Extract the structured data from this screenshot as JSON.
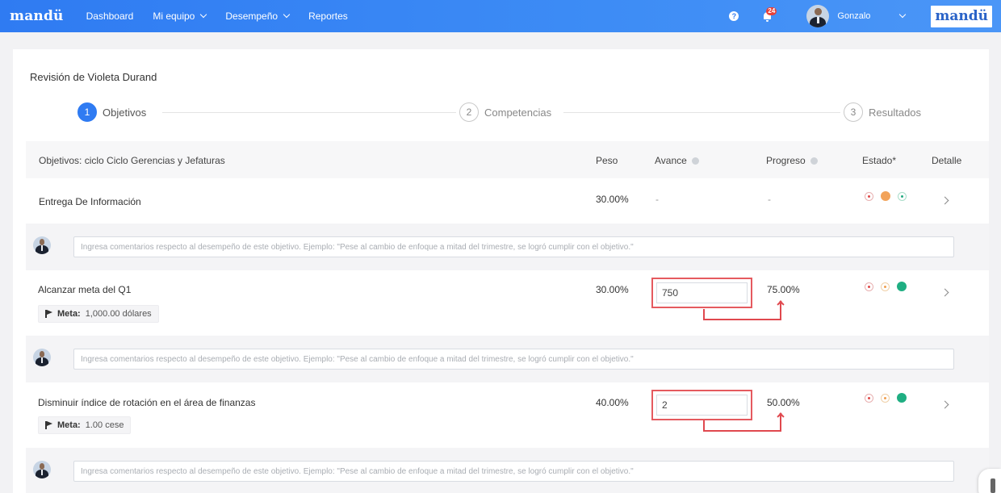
{
  "nav": {
    "brand": "mandü",
    "items": [
      {
        "label": "Dashboard",
        "has_dropdown": false
      },
      {
        "label": "Mi equipo",
        "has_dropdown": true
      },
      {
        "label": "Desempeño",
        "has_dropdown": true
      },
      {
        "label": "Reportes",
        "has_dropdown": false
      }
    ],
    "help_icon": "?",
    "notifications_count": "24",
    "user_name": "Gonzalo",
    "brand_right": "mandü",
    "accent": "#2f7bf2"
  },
  "review": {
    "title": "Revisión de Violeta Durand"
  },
  "steps": [
    {
      "number": "1",
      "label": "Objetivos",
      "active": true
    },
    {
      "number": "2",
      "label": "Competencias",
      "active": false
    },
    {
      "number": "3",
      "label": "Resultados",
      "active": false
    }
  ],
  "table": {
    "headers": {
      "objective": "Objetivos: ciclo Ciclo Gerencias y Jefaturas",
      "peso": "Peso",
      "avance": "Avance",
      "progreso": "Progreso",
      "estado": "Estado*",
      "detalle": "Detalle"
    },
    "rows": [
      {
        "name": "Entrega De Información",
        "peso": "30.00%",
        "avance": "-",
        "progreso": "-",
        "meta_label": "",
        "meta_value": "",
        "estado": "orange"
      },
      {
        "name": "Alcanzar meta del Q1",
        "peso": "30.00%",
        "avance": "750",
        "progreso": "75.00%",
        "meta_label": "Meta:",
        "meta_value": "1,000.00 dólares",
        "estado": "green"
      },
      {
        "name": "Disminuir índice de rotación en el área de finanzas",
        "peso": "40.00%",
        "avance": "2",
        "progreso": "50.00%",
        "meta_label": "Meta:",
        "meta_value": "1.00 cese",
        "estado": "green"
      }
    ],
    "comment_placeholder": "Ingresa comentarios respecto al desempeño de este objetivo. Ejemplo: \"Pese al cambio de enfoque a mitad del trimestre, se logró cumplir con el objetivo.\""
  },
  "colors": {
    "highlight": "#e55a5f",
    "status_orange": "#f2a35a",
    "status_green": "#1fae82",
    "status_red": "#e04848"
  }
}
